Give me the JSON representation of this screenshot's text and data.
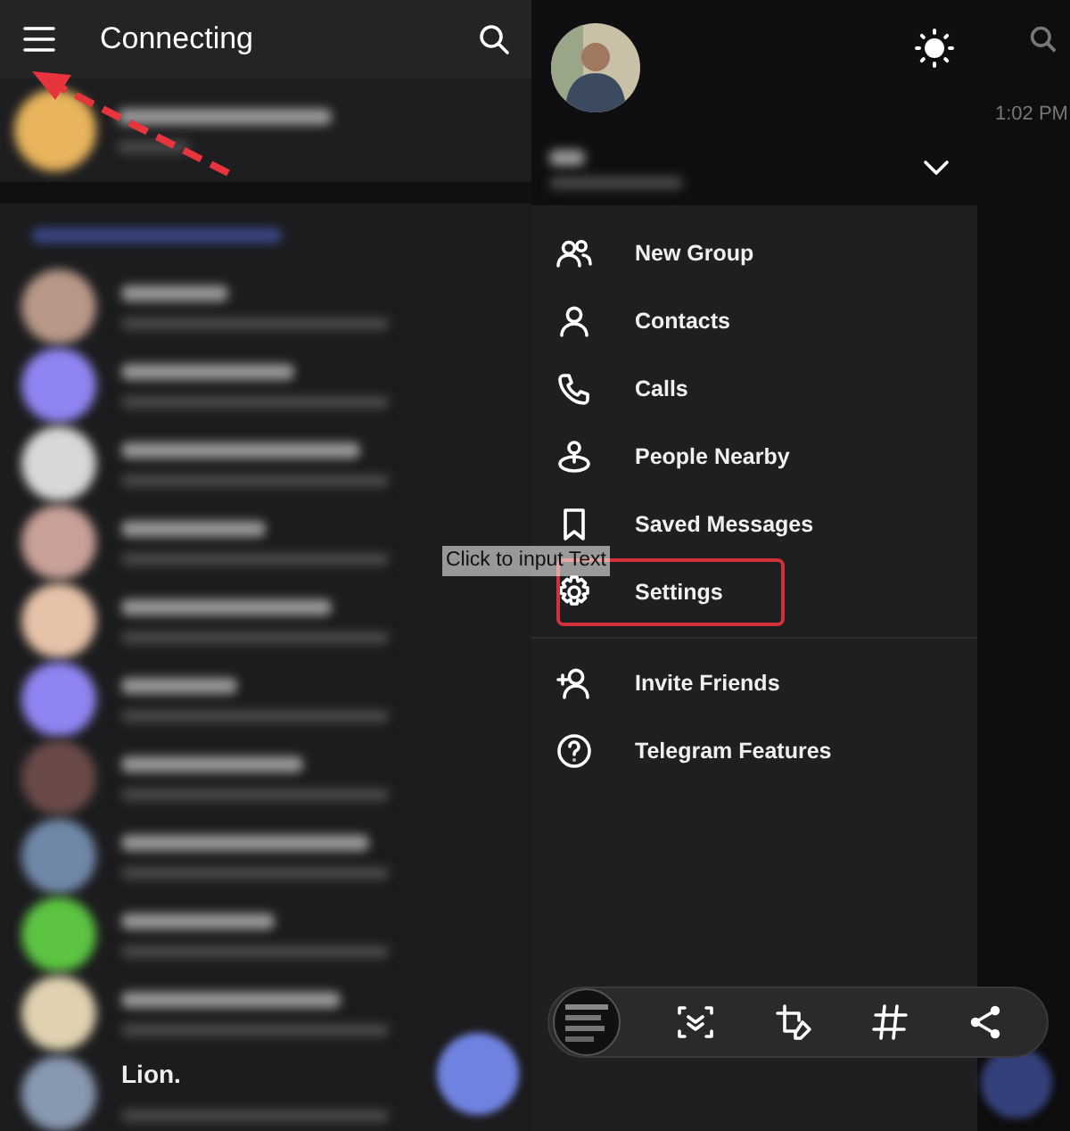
{
  "app_bar": {
    "title": "Connecting"
  },
  "pinned_chat": {
    "color": "#e8b45c"
  },
  "chats": [
    {
      "color": "#b89888"
    },
    {
      "color": "#8f85f2"
    },
    {
      "color": "#d8d8d8"
    },
    {
      "color": "#c8a098"
    },
    {
      "color": "#e6c2a8"
    },
    {
      "color": "#8f85f2"
    },
    {
      "color": "#6a4a48"
    },
    {
      "color": "#7088a8"
    },
    {
      "color": "#5cc442"
    },
    {
      "color": "#e0d2b0"
    },
    {
      "color": "#8898b0"
    }
  ],
  "last_chat_name": "Lion.",
  "drawer": {
    "sections": [
      [
        {
          "label": "New Group",
          "highlighted": false
        },
        {
          "label": "Contacts",
          "highlighted": false
        },
        {
          "label": "Calls",
          "highlighted": false
        },
        {
          "label": "People Nearby",
          "highlighted": false
        },
        {
          "label": "Saved Messages",
          "highlighted": false
        },
        {
          "label": "Settings",
          "highlighted": true
        }
      ],
      [
        {
          "label": "Invite Friends",
          "highlighted": false
        },
        {
          "label": "Telegram Features",
          "highlighted": false
        }
      ]
    ]
  },
  "background_chat": {
    "time": "1:02 PM"
  },
  "overlay_text": "Click to input Text"
}
